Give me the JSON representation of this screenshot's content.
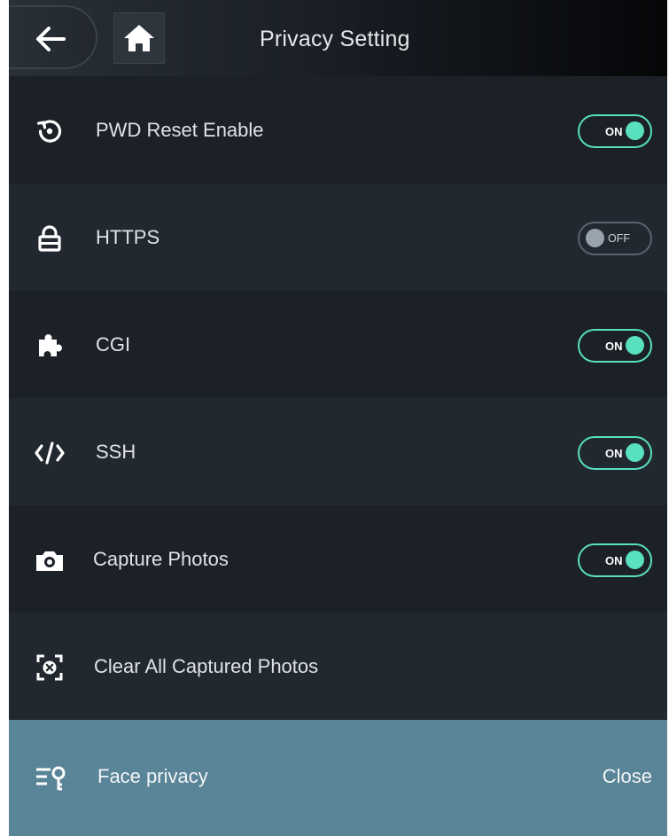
{
  "header": {
    "title": "Privacy Setting",
    "back_icon": "arrow-left-icon",
    "home_icon": "home-icon"
  },
  "settings": [
    {
      "label": "PWD Reset Enable",
      "icon": "reset-icon",
      "toggle": "ON"
    },
    {
      "label": "HTTPS",
      "icon": "lock-icon",
      "toggle": "OFF"
    },
    {
      "label": "CGI",
      "icon": "puzzle-icon",
      "toggle": "ON"
    },
    {
      "label": "SSH",
      "icon": "code-icon",
      "toggle": "ON"
    },
    {
      "label": "Capture Photos",
      "icon": "camera-icon",
      "toggle": "ON"
    },
    {
      "label": "Clear All Captured Photos",
      "icon": "clear-photos-icon"
    }
  ],
  "face_privacy": {
    "label": "Face privacy",
    "value": "Close",
    "icon": "face-privacy-icon"
  },
  "colors": {
    "background": "#1c2128",
    "row_alt": "#222830",
    "accent_on": "#58e0bf",
    "toggle_off": "#98a3ad",
    "highlight_row": "#5a8497"
  }
}
